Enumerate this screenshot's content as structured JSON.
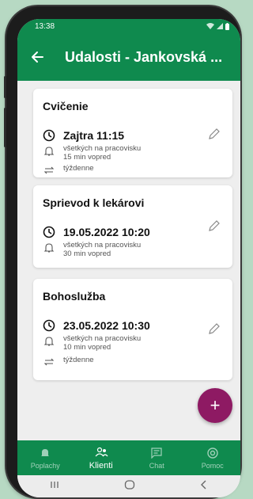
{
  "status_bar": {
    "time": "13:38"
  },
  "app_bar": {
    "title": "Udalosti - Jankovská ..."
  },
  "events": [
    {
      "title": "Cvičenie",
      "when": "Zajtra 11:15",
      "audience": "všetkých na pracovisku",
      "reminder": "15 min vopred",
      "repeat": "týždenne"
    },
    {
      "title": "Sprievod k lekárovi",
      "when": "19.05.2022 10:20",
      "audience": "všetkých na pracovisku",
      "reminder": "30 min vopred"
    },
    {
      "title": "Bohoslužba",
      "when": "23.05.2022 10:30",
      "audience": "všetkých na pracovisku",
      "reminder": "10 min vopred",
      "repeat": "týždenne"
    }
  ],
  "fab": {
    "label": "+"
  },
  "bottom_nav": [
    {
      "label": "Poplachy",
      "icon": "bell-icon"
    },
    {
      "label": "Klienti",
      "icon": "people-icon",
      "active": true
    },
    {
      "label": "Chat",
      "icon": "chat-icon"
    },
    {
      "label": "Pomoc",
      "icon": "lifebuoy-icon"
    }
  ],
  "colors": {
    "primary": "#0f8a4e",
    "accent": "#8e1a63",
    "background": "#eeeeee"
  }
}
